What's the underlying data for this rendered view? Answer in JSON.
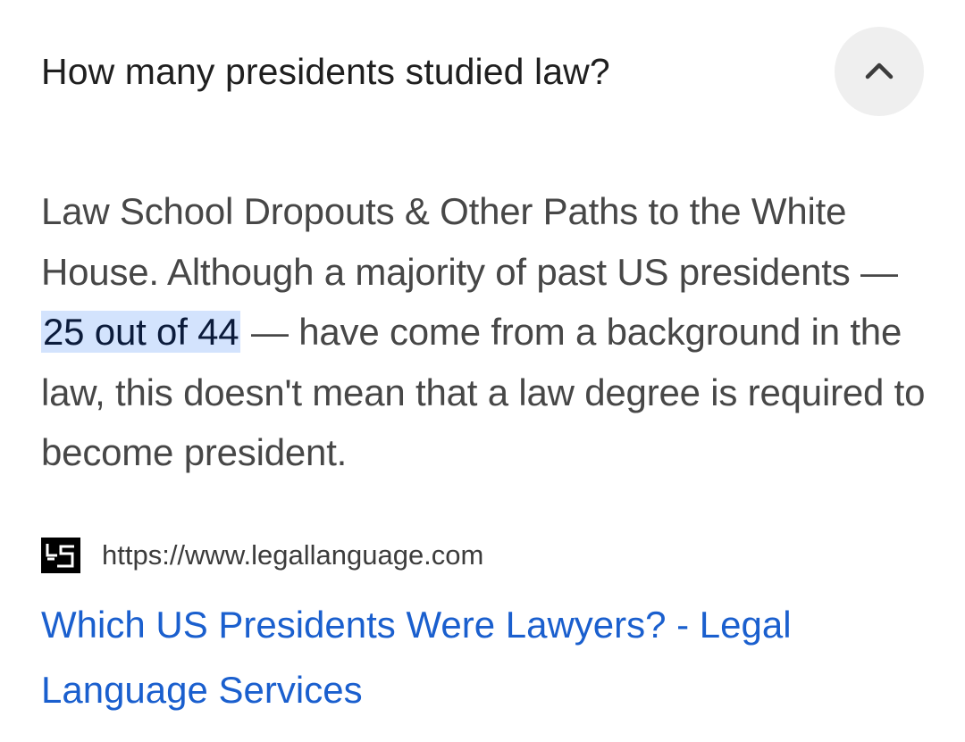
{
  "question": {
    "text": "How many presidents studied law?",
    "toggle_icon": "chevron-up-icon"
  },
  "answer": {
    "text_before": "Law School Dropouts & Other Paths to the White House. Although a majority of past US presidents — ",
    "highlight": "25 out of 44",
    "text_after": " — have come from a background in the law, this doesn't mean that a law degree is required to become president."
  },
  "source": {
    "favicon_icon": "ls-logo-icon",
    "url": "https://www.legallanguage.com"
  },
  "result": {
    "title": "Which US Presidents Were Lawyers? - Legal Language Services"
  },
  "colors": {
    "link": "#1a5fce",
    "highlight_bg": "#d3e3fd",
    "button_bg": "#efefef"
  }
}
